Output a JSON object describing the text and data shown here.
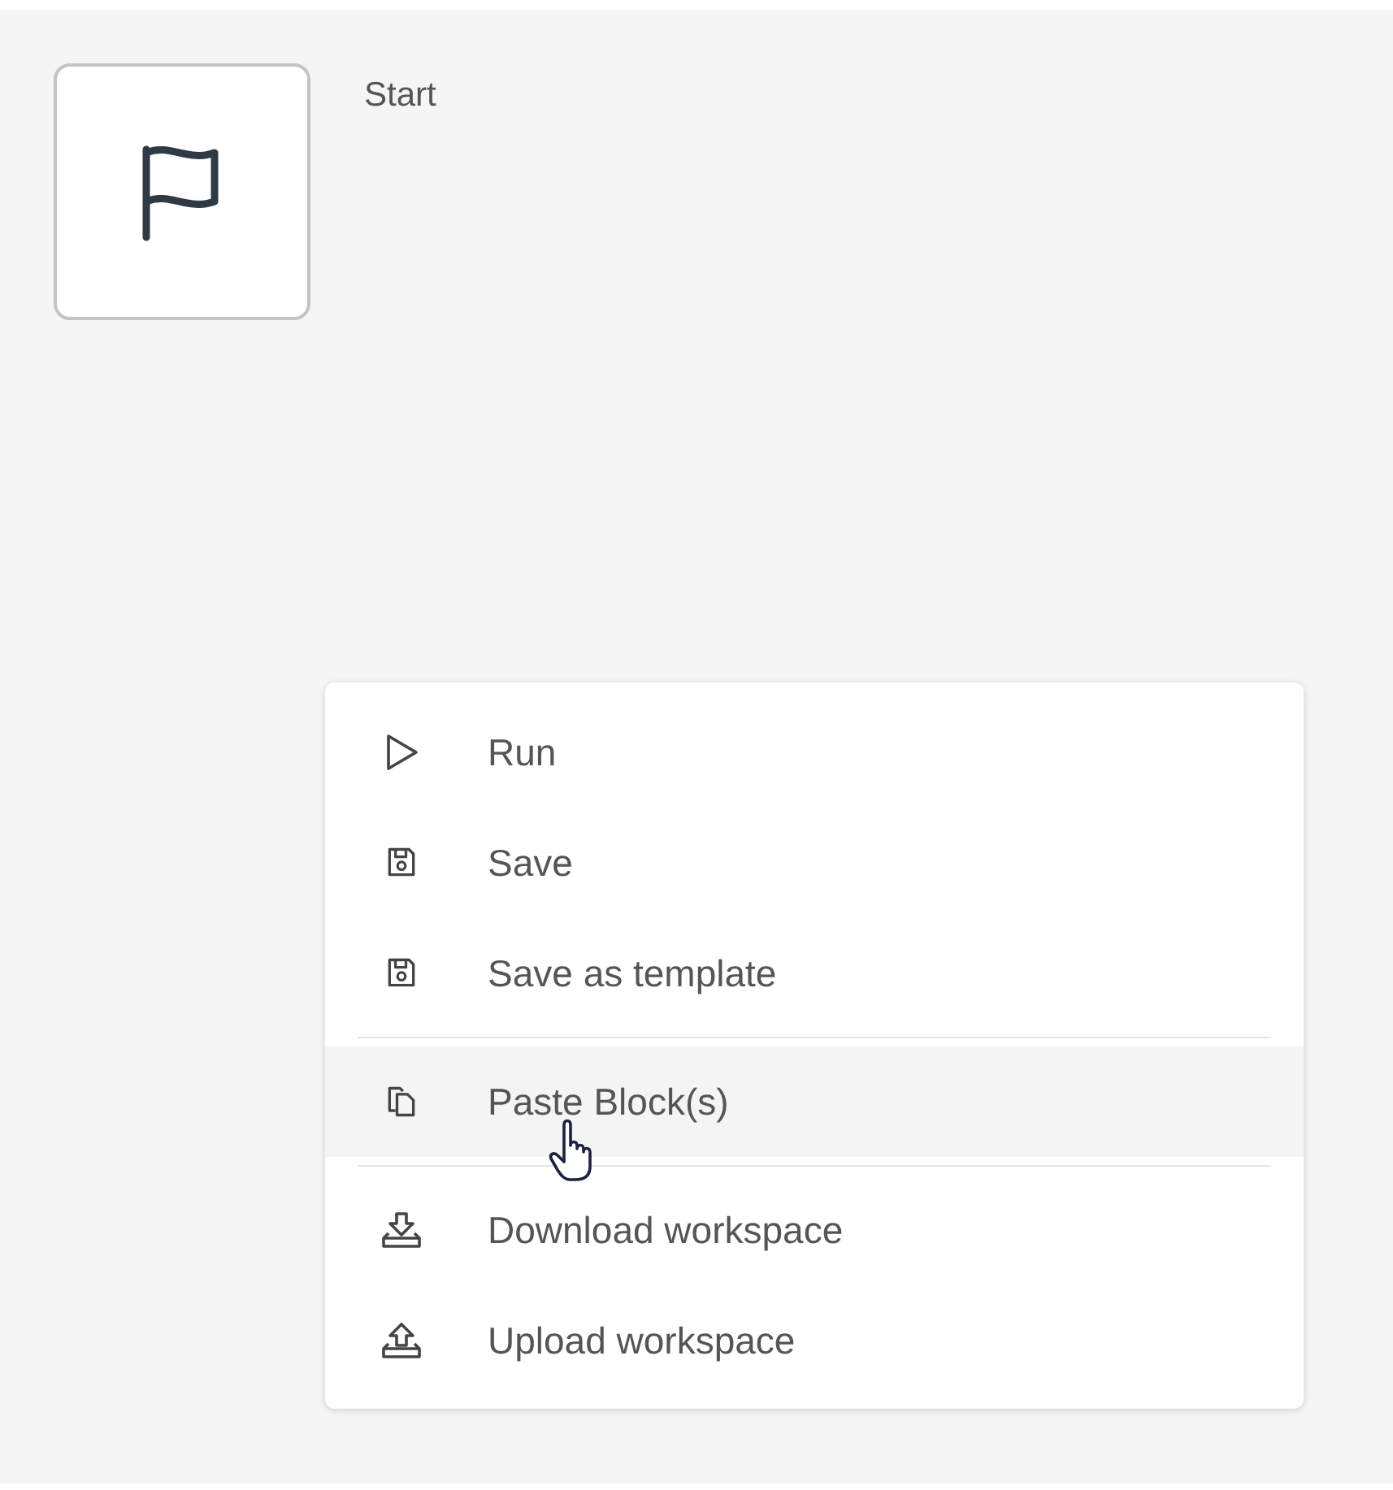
{
  "canvas": {
    "block": {
      "label": "Start"
    }
  },
  "context_menu": {
    "items": [
      {
        "kind": "item",
        "label": "Run",
        "highlighted": false
      },
      {
        "kind": "item",
        "label": "Save",
        "highlighted": false
      },
      {
        "kind": "item",
        "label": "Save as template",
        "highlighted": false
      },
      {
        "kind": "separator"
      },
      {
        "kind": "item",
        "label": "Paste Block(s)",
        "highlighted": true
      },
      {
        "kind": "separator"
      },
      {
        "kind": "item",
        "label": "Download workspace",
        "highlighted": false
      },
      {
        "kind": "item",
        "label": "Upload workspace",
        "highlighted": false
      }
    ]
  }
}
